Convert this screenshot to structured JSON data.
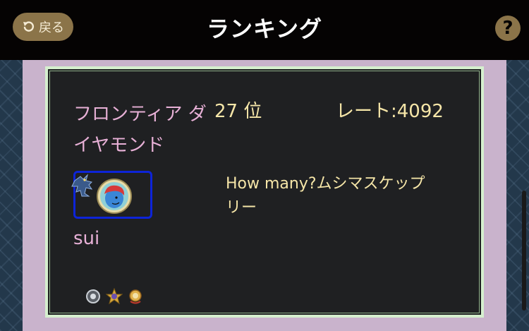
{
  "header": {
    "back_label": "戻る",
    "title": "ランキング",
    "help_label": "?"
  },
  "entry": {
    "rank_name": "フロンティア ダイヤモンド",
    "position": "27 位",
    "rate": "レート:4092",
    "username": "sui",
    "comment": "How many?ムシマスケップリー",
    "badges": [
      "silver-orb-badge-icon",
      "gold-star-badge-icon",
      "gold-wreath-badge-icon"
    ]
  },
  "colors": {
    "accent_gold": "#8b7449",
    "rank_pink": "#e7b0d6",
    "text_yellow": "#f6e6a8",
    "frame_blue": "#0d24d8"
  }
}
